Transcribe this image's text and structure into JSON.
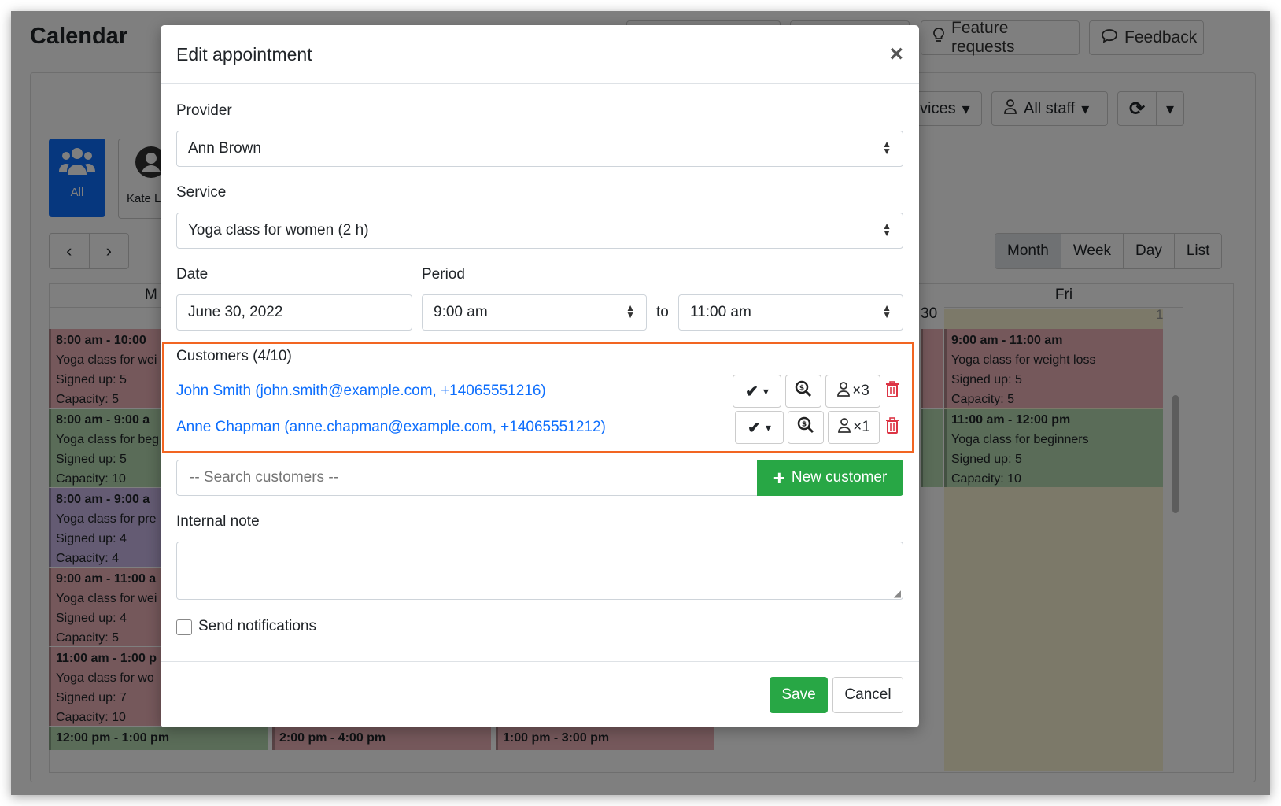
{
  "app": {
    "title": "Calendar",
    "feature_requests": "Feature requests",
    "feedback": "Feedback",
    "services_filter": "vices",
    "staff_filter": "All staff",
    "staff_all": "All",
    "staff_kate": "Kate L",
    "views": [
      "Month",
      "Week",
      "Day",
      "List"
    ],
    "col_mon": "M",
    "col_fri": "Fri",
    "day_30": "30",
    "day_1": "1"
  },
  "events_mon": [
    {
      "time": "8:00 am - 10:00",
      "name": "Yoga class for wei",
      "signed": "Signed up: 5",
      "cap": "Capacity: 5",
      "color": "red"
    },
    {
      "time": "8:00 am - 9:00 a",
      "name": "Yoga class for beg",
      "signed": "Signed up: 5",
      "cap": "Capacity: 10",
      "color": "green"
    },
    {
      "time": "8:00 am - 9:00 a",
      "name": "Yoga class for pre",
      "signed": "Signed up: 4",
      "cap": "Capacity: 4",
      "color": "purple"
    },
    {
      "time": "9:00 am - 11:00 a",
      "name": "Yoga class for wei",
      "signed": "Signed up: 4",
      "cap": "Capacity: 5",
      "color": "red"
    },
    {
      "time": "11:00 am - 1:00 p",
      "name": "Yoga class for wo",
      "signed": "Signed up: 7",
      "cap": "Capacity: 10",
      "color": "red"
    }
  ],
  "events_fri": [
    {
      "time": "9:00 am - 11:00 am",
      "name": "Yoga class for weight loss",
      "signed": "Signed up: 5",
      "cap": "Capacity: 5",
      "color": "red"
    },
    {
      "time": "11:00 am - 12:00 pm",
      "name": "Yoga class for beginners",
      "signed": "Signed up: 5",
      "cap": "Capacity: 10",
      "color": "green"
    }
  ],
  "bottom_times": [
    "12:00 pm - 1:00 pm",
    "2:00 pm - 4:00 pm",
    "1:00 pm - 3:00 pm"
  ],
  "modal": {
    "title": "Edit appointment",
    "provider_label": "Provider",
    "provider_value": "Ann Brown",
    "service_label": "Service",
    "service_value": "Yoga class for women (2 h)",
    "date_label": "Date",
    "date_value": "June 30, 2022",
    "period_label": "Period",
    "period_from": "9:00 am",
    "period_to_label": "to",
    "period_to": "11:00 am",
    "customers_label": "Customers (4/10)",
    "customers": [
      {
        "text": "John Smith (john.smith@example.com, +14065551216)",
        "count": "×3"
      },
      {
        "text": "Anne Chapman (anne.chapman@example.com, +14065551212)",
        "count": "×1"
      }
    ],
    "search_placeholder": "-- Search customers --",
    "new_customer": "New customer",
    "internal_note_label": "Internal note",
    "send_notifications": "Send notifications",
    "save": "Save",
    "cancel": "Cancel"
  }
}
